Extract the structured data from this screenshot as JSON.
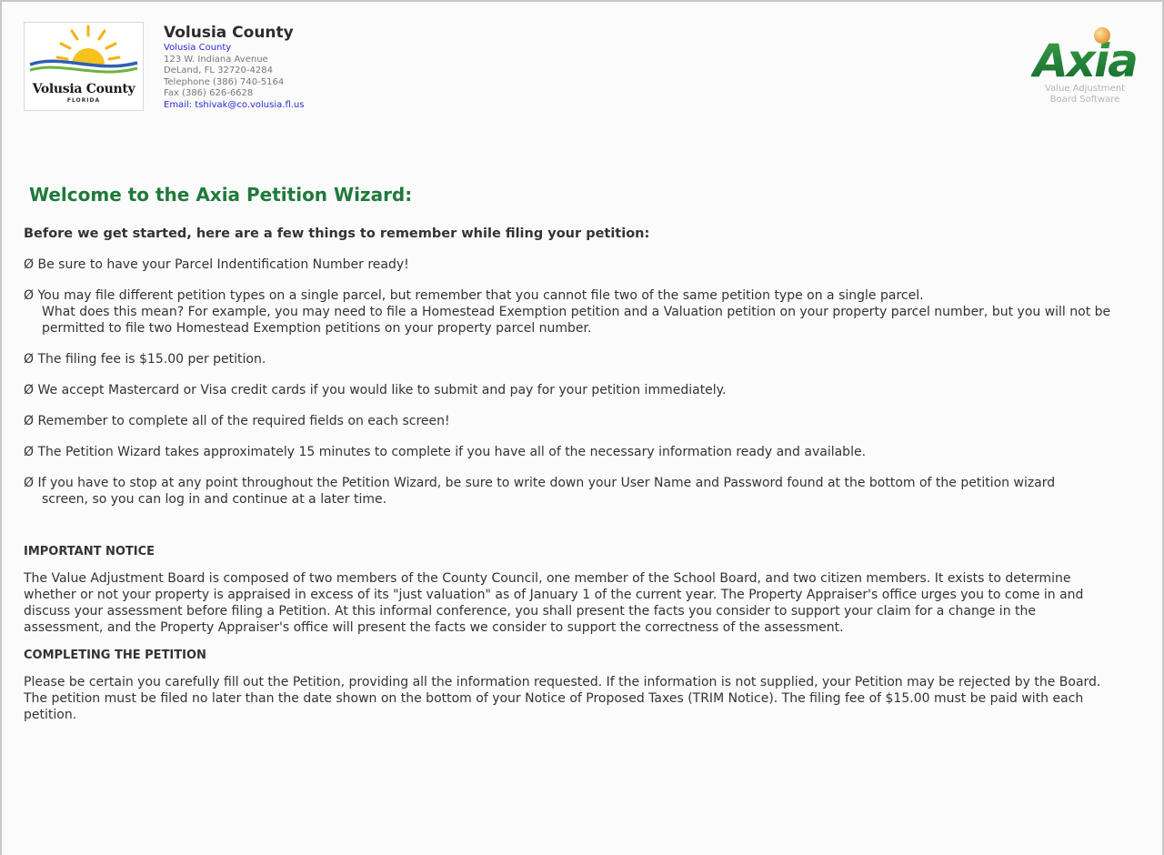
{
  "header": {
    "logo": {
      "text": "Volusia County",
      "sub": "FLORIDA"
    },
    "county_name": "Volusia County",
    "county_link": "Volusia County",
    "address1": "123 W. Indiana Avenue",
    "address2": "DeLand, FL 32720-4284",
    "telephone": "Telephone (386) 740-5164",
    "fax": "Fax (386) 626-6628",
    "email": "Email: tshivak@co.volusia.fl.us",
    "brand": {
      "name": "Axia",
      "line1": "Value Adjustment",
      "line2": "Board Software"
    }
  },
  "title": "Welcome to the Axia Petition Wizard:",
  "intro": "Before we get started, here are a few things to remember while filing your petition:",
  "bullet_symbol": "Ø",
  "bullets": {
    "b1": "Be sure to have your Parcel Indentification Number ready!",
    "b2": "You may file different petition types on a single parcel, but remember that you cannot file two of the same petition type on a single parcel.",
    "b2a": "What does this mean?  For example, you may need to file a Homestead Exemption petition and a Valuation petition on your property parcel number, but you will not be",
    "b2b": "permitted to file two Homestead Exemption petitions on your property parcel number.",
    "b3": "The filing fee is $15.00 per petition.",
    "b4": "We accept Mastercard or Visa credit cards if you would like to submit and pay for your petition immediately.",
    "b5": "Remember to complete all of the required fields on each screen!",
    "b6": "The Petition Wizard takes approximately 15 minutes to complete if you have all of the necessary information ready and available.",
    "b7": "If you have to stop at any point throughout the Petition Wizard, be sure to write down your User Name and Password found at the bottom of the petition wizard",
    "b7b": "screen, so you can log in and continue at a later time."
  },
  "notice": {
    "heading": "IMPORTANT NOTICE",
    "l1": "The Value Adjustment Board is composed of two members of the County Council, one member of the School Board, and two citizen members. It exists to determine",
    "l2": "whether or not your property is appraised in excess of its \"just valuation\" as of January 1 of the current year. The Property Appraiser's office urges you to come in and",
    "l3": "discuss your assessment before filing a Petition. At this informal conference, you shall present the facts you consider to support your claim for a change in the",
    "l4": "assessment, and the Property Appraiser's office will present the facts we consider to support the correctness of the assessment."
  },
  "completing": {
    "heading": "COMPLETING THE PETITION",
    "l1": "Please be certain you carefully fill out the Petition, providing all the information requested. If the information is not supplied, your Petition may be rejected by the Board.",
    "l2": "The petition must be filed no later than the date shown on the bottom of your Notice of Proposed Taxes (TRIM Notice). The filing fee of $15.00 must be paid with each",
    "l3": "petition."
  }
}
